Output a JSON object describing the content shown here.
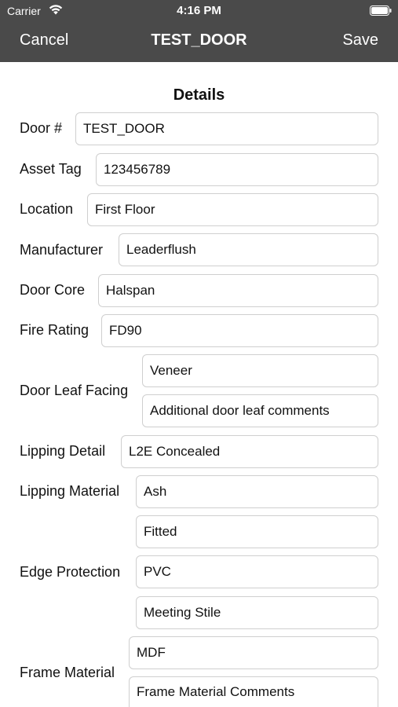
{
  "status_bar": {
    "carrier": "Carrier",
    "time": "4:16 PM"
  },
  "nav": {
    "cancel_label": "Cancel",
    "title": "TEST_DOOR",
    "save_label": "Save"
  },
  "section": {
    "title": "Details"
  },
  "fields": {
    "door_number": {
      "label": "Door #",
      "value": "TEST_DOOR"
    },
    "asset_tag": {
      "label": "Asset Tag",
      "value": "123456789"
    },
    "location": {
      "label": "Location",
      "value": "First Floor"
    },
    "manufacturer": {
      "label": "Manufacturer",
      "value": "Leaderflush"
    },
    "door_core": {
      "label": "Door Core",
      "value": "Halspan"
    },
    "fire_rating": {
      "label": "Fire Rating",
      "value": "FD90"
    },
    "door_leaf_facing": {
      "label": "Door Leaf Facing",
      "value": "Veneer",
      "comments": "Additional door leaf comments"
    },
    "lipping_detail": {
      "label": "Lipping Detail",
      "value": "L2E Concealed"
    },
    "lipping_material": {
      "label": "Lipping Material",
      "value": "Ash"
    },
    "edge_protection": {
      "label": "Edge Protection",
      "values": [
        "Fitted",
        "PVC",
        "Meeting Stile"
      ]
    },
    "frame_material": {
      "label": "Frame Material",
      "value": "MDF",
      "comments": "Frame Material Comments"
    }
  }
}
